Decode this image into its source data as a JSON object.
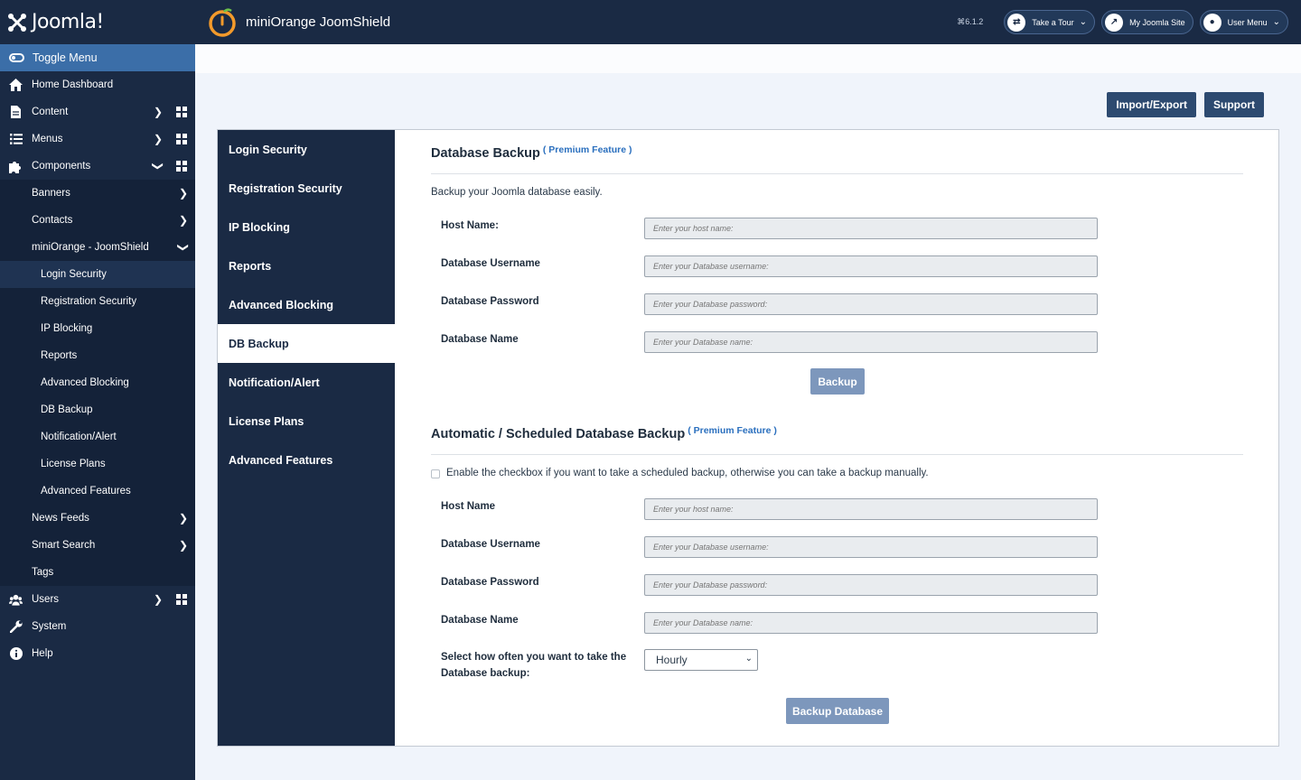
{
  "brand": {
    "name": "Joomla!"
  },
  "header": {
    "title": "miniOrange JoomShield",
    "version": "⌘6.1.2",
    "take_tour": "Take a Tour",
    "my_site": "My Joomla Site",
    "user_menu": "User Menu"
  },
  "sidebar": {
    "toggle": "Toggle Menu",
    "home": "Home Dashboard",
    "content": "Content",
    "menus": "Menus",
    "components": "Components",
    "components_sub": {
      "banners": "Banners",
      "contacts": "Contacts",
      "joomshield": "miniOrange - JoomShield",
      "joomshield_items": [
        "Login Security",
        "Registration Security",
        "IP Blocking",
        "Reports",
        "Advanced Blocking",
        "DB Backup",
        "Notification/Alert",
        "License Plans",
        "Advanced Features"
      ],
      "news_feeds": "News Feeds",
      "smart_search": "Smart Search",
      "tags": "Tags"
    },
    "users": "Users",
    "system": "System",
    "help": "Help"
  },
  "toolbar": {
    "import_export": "Import/Export",
    "support": "Support"
  },
  "tabs": [
    "Login Security",
    "Registration Security",
    "IP Blocking",
    "Reports",
    "Advanced Blocking",
    "DB Backup",
    "Notification/Alert",
    "License Plans",
    "Advanced Features"
  ],
  "backup": {
    "title": "Database Backup",
    "premium": "( Premium Feature )",
    "description": "Backup your Joomla database easily.",
    "host_label": "Host Name:",
    "host_placeholder": "Enter your host name:",
    "user_label": "Database Username",
    "user_placeholder": "Enter your Database username:",
    "pass_label": "Database Password",
    "pass_placeholder": "Enter your Database password:",
    "name_label": "Database Name",
    "name_placeholder": "Enter your Database name:",
    "button": "Backup"
  },
  "scheduled": {
    "title": "Automatic / Scheduled Database Backup",
    "premium": "( Premium Feature )",
    "checkbox_label": "Enable the checkbox if you want to take a scheduled backup, otherwise you can take a backup manually.",
    "host_label": "Host Name",
    "host_placeholder": "Enter your host name:",
    "user_label": "Database Username",
    "user_placeholder": "Enter your Database username:",
    "pass_label": "Database Password",
    "pass_placeholder": "Enter your Database password:",
    "name_label": "Database Name",
    "name_placeholder": "Enter your Database name:",
    "frequency_label": "Select how often you want to take the Database backup:",
    "frequency_value": "Hourly",
    "button": "Backup Database"
  }
}
